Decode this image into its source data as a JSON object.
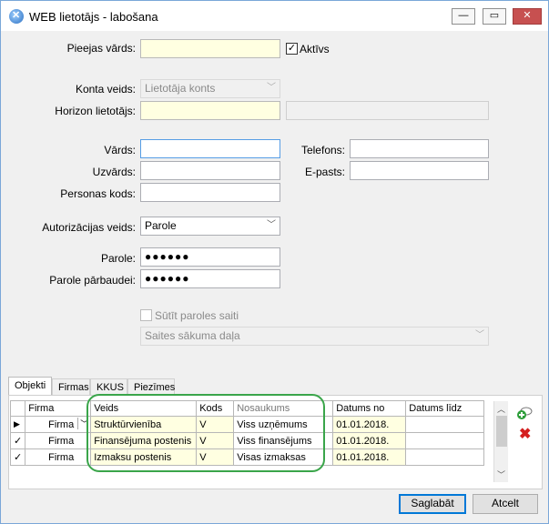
{
  "window": {
    "title": "WEB lietotājs - labošana"
  },
  "form": {
    "pieejas_vards_label": "Pieejas vārds:",
    "pieejas_vards_value": "",
    "aktivs_label": "Aktīvs",
    "konta_veids_label": "Konta veids:",
    "konta_veids_value": "Lietotāja konts",
    "horizon_label": "Horizon lietotājs:",
    "vards_label": "Vārds:",
    "uzvards_label": "Uzvārds:",
    "personas_kods_label": "Personas kods:",
    "telefons_label": "Telefons:",
    "epasts_label": "E-pasts:",
    "autorizacijas_label": "Autorizācijas veids:",
    "autorizacijas_value": "Parole",
    "parole_label": "Parole:",
    "parole_value": "●●●●●●",
    "parole_parb_label": "Parole pārbaudei:",
    "parole_parb_value": "●●●●●●",
    "sutit_label": "Sūtīt paroles saiti",
    "saites_value": "Saites sākuma daļa"
  },
  "tabs": [
    "Objekti",
    "Firmas",
    "KKUS",
    "Piezīmes"
  ],
  "grid": {
    "headers": [
      "Firma",
      "Veids",
      "Kods",
      "Nosaukums",
      "Datums no",
      "Datums līdz"
    ],
    "rows": [
      {
        "marker": "▶",
        "firma": "Firma",
        "veids": "Struktūrvienība",
        "kods": "V",
        "nosaukums": "Viss uzņēmums",
        "datums_no": "01.01.2018.",
        "datums_lidz": ""
      },
      {
        "marker": "✓",
        "firma": "Firma",
        "veids": "Finansējuma postenis",
        "kods": "V",
        "nosaukums": "Viss finansējums",
        "datums_no": "01.01.2018.",
        "datums_lidz": ""
      },
      {
        "marker": "✓",
        "firma": "Firma",
        "veids": "Izmaksu postenis",
        "kods": "V",
        "nosaukums": "Visas izmaksas",
        "datums_no": "01.01.2018.",
        "datums_lidz": ""
      }
    ]
  },
  "buttons": {
    "save": "Saglabāt",
    "cancel": "Atcelt"
  }
}
